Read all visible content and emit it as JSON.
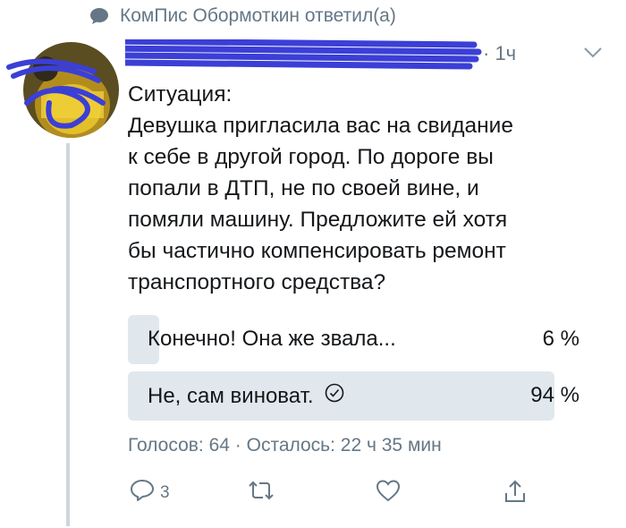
{
  "retweet_header": {
    "text": "КомПис Обормоткин ответил(а)",
    "icon": "speech-bubble-icon"
  },
  "tweet": {
    "time": "· 1ч",
    "lines": [
      "Ситуация:",
      "Девушка пригласила вас на свидание",
      "к себе в другой город. По дороге вы",
      "попали в ДТП, не по своей вине, и",
      "помяли машину. Предложите ей хотя",
      "бы частично компенсировать ремонт",
      "транспортного средства?"
    ]
  },
  "poll": {
    "options": [
      {
        "label": "Конечно! Она же звала...",
        "percent": "6 %",
        "fraction": 0.06
      },
      {
        "label": "Не, сам виноват.",
        "percent": "94 %",
        "fraction": 0.94,
        "selected": true
      }
    ],
    "meta": "Голосов: 64 · Осталось: 22 ч 35 мин"
  },
  "actions": {
    "reply_count": "3",
    "icons": [
      "reply-icon",
      "retweet-icon",
      "like-icon",
      "share-icon"
    ]
  },
  "colors": {
    "secondary_text": "#657786",
    "poll_fill": "#e1e8ed",
    "scribble": "#3b3fd6"
  }
}
